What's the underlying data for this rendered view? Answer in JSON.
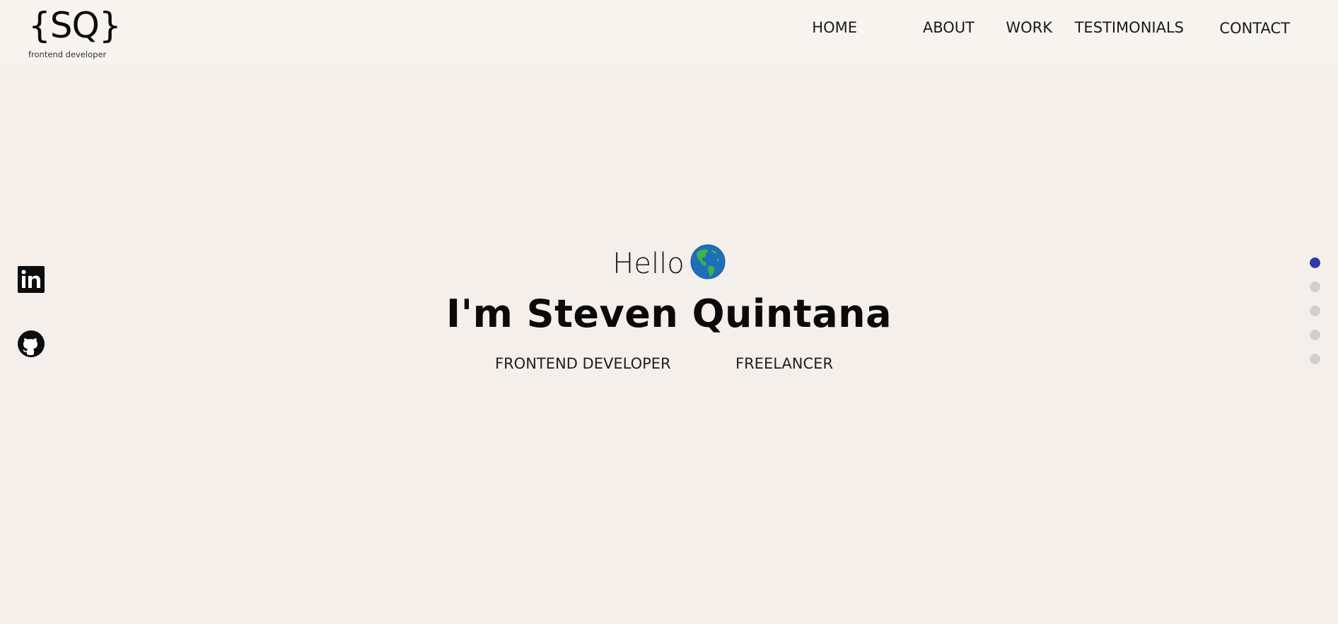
{
  "logo": {
    "mark": "{SQ}",
    "subtitle": "frontend developer"
  },
  "nav": {
    "items": [
      {
        "label": "HOME"
      },
      {
        "label": "ABOUT"
      },
      {
        "label": "WORK"
      },
      {
        "label": "TESTIMONIALS"
      },
      {
        "label": "CONTACT"
      }
    ]
  },
  "social": {
    "linkedin_icon": "linkedin-icon",
    "github_icon": "github-icon"
  },
  "hero": {
    "greeting": "Hello",
    "globe_icon": "globe-americas-icon",
    "name": "I'm Steven Quintana",
    "roles": [
      "FRONTEND DEVELOPER",
      "FREELANCER"
    ]
  },
  "section_dots": {
    "count": 5,
    "active_index": 0,
    "active_color": "#2f3aa8",
    "inactive_color": "#cfcfcf"
  },
  "colors": {
    "background": "#f4efea",
    "header_background": "#f7f3ef",
    "text": "#111111"
  }
}
